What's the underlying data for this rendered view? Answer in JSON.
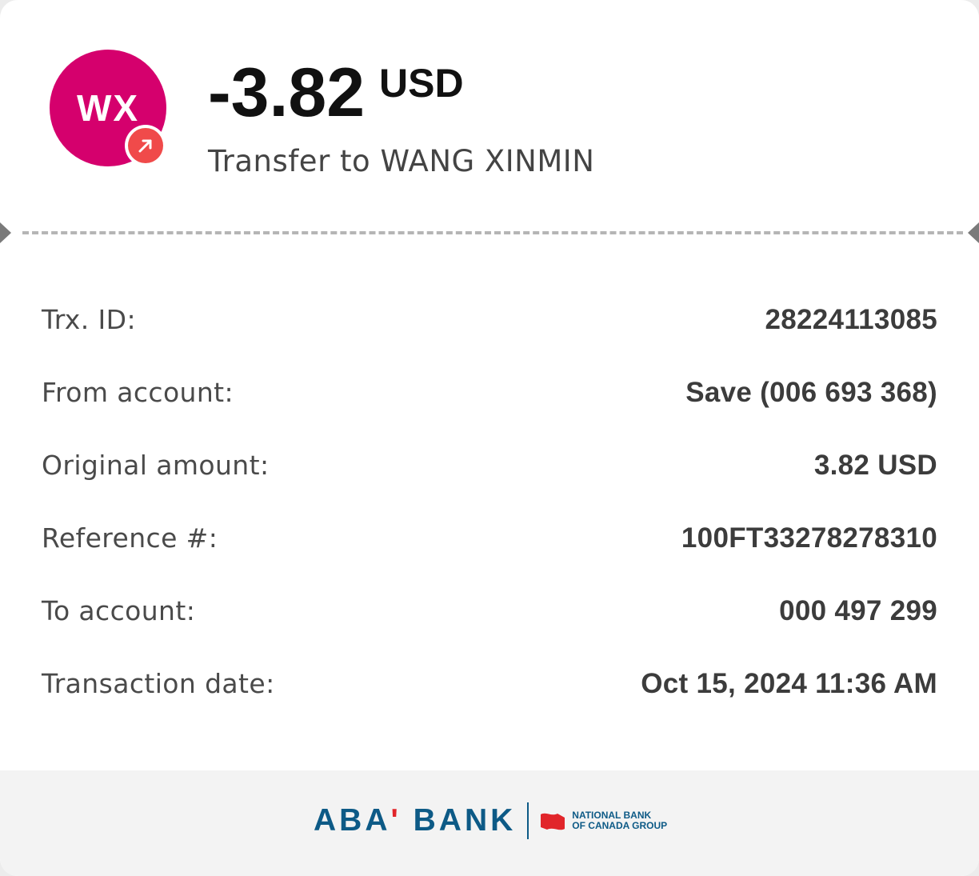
{
  "header": {
    "avatar_initials": "WX",
    "amount": "-3.82",
    "currency": "USD",
    "title": "Transfer to WANG XINMIN"
  },
  "details": [
    {
      "label": "Trx. ID:",
      "value": "28224113085"
    },
    {
      "label": "From account:",
      "value": "Save (006 693 368)"
    },
    {
      "label": "Original amount:",
      "value": "3.82 USD"
    },
    {
      "label": "Reference #:",
      "value": "100FT33278278310"
    },
    {
      "label": "To account:",
      "value": "000 497 299"
    },
    {
      "label": "Transaction date:",
      "value": "Oct 15, 2024 11:36 AM"
    }
  ],
  "footer": {
    "brand_name_pre": "ABA",
    "brand_apostrophe": "'",
    "brand_name_post": " BANK",
    "partner_line1": "NATIONAL BANK",
    "partner_line2": "OF CANADA GROUP"
  },
  "colors": {
    "avatar_bg": "#d5006d",
    "badge_bg": "#f04a4a",
    "brand_blue": "#0d5a86",
    "brand_red": "#e1252a"
  },
  "icons": {
    "badge": "arrow-up-right-icon",
    "partner_logo": "flag-icon"
  }
}
